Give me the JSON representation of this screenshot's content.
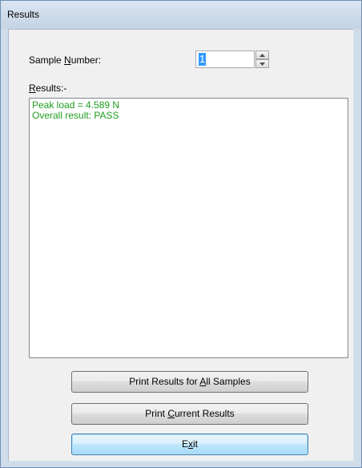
{
  "window": {
    "title": "Results"
  },
  "sample_number": {
    "label_prefix": "Sample ",
    "label_accel": "N",
    "label_suffix": "umber:",
    "value": "1"
  },
  "results": {
    "label_accel": "R",
    "label_suffix": "esults:-",
    "lines": [
      "Peak load = 4.589 N",
      "Overall result: PASS"
    ],
    "text_color": "#1e9e1e"
  },
  "buttons": {
    "print_all": {
      "prefix": "Print Results for ",
      "accel": "A",
      "suffix": "ll Samples"
    },
    "print_current": {
      "prefix": "Print ",
      "accel": "C",
      "suffix": "urrent Results"
    },
    "exit": {
      "prefix": "E",
      "accel": "x",
      "suffix": "it"
    }
  }
}
